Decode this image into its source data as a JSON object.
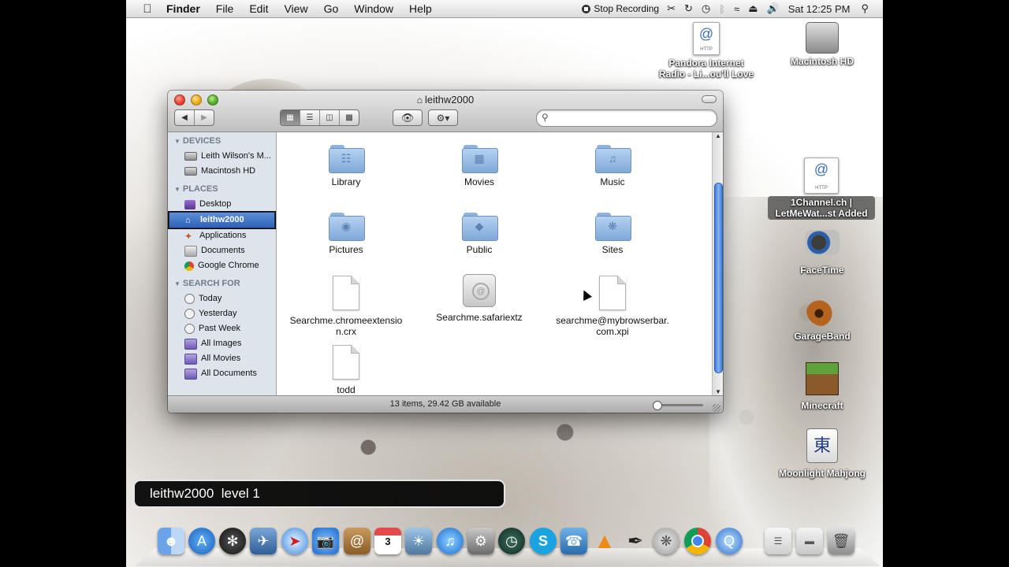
{
  "menubar": {
    "app_name": "Finder",
    "items": [
      "File",
      "Edit",
      "View",
      "Go",
      "Window",
      "Help"
    ],
    "recording_label": "Stop Recording",
    "clock": "Sat 12:25 PM"
  },
  "desktop": {
    "icons": [
      {
        "label": "Pandora Internet Radio - Li...ou'll Love"
      },
      {
        "label": "Macintosh HD"
      },
      {
        "label": "1Channel.ch | LetMeWat...st Added"
      },
      {
        "label": "FaceTime"
      },
      {
        "label": "GarageBand"
      },
      {
        "label": "Minecraft"
      },
      {
        "label": "Moonlight Mahjong"
      }
    ]
  },
  "finder": {
    "title": "leithw2000",
    "search_placeholder": "",
    "sidebar": {
      "devices_header": "DEVICES",
      "devices": [
        "Leith Wilson's M...",
        "Macintosh HD"
      ],
      "places_header": "PLACES",
      "places": [
        "Desktop",
        "leithw2000",
        "Applications",
        "Documents",
        "Google Chrome"
      ],
      "search_header": "SEARCH FOR",
      "search": [
        "Today",
        "Yesterday",
        "Past Week",
        "All Images",
        "All Movies",
        "All Documents"
      ]
    },
    "items": [
      {
        "name": "Library",
        "kind": "folder"
      },
      {
        "name": "Movies",
        "kind": "folder"
      },
      {
        "name": "Music",
        "kind": "folder"
      },
      {
        "name": "Pictures",
        "kind": "folder"
      },
      {
        "name": "Public",
        "kind": "folder"
      },
      {
        "name": "Sites",
        "kind": "folder"
      },
      {
        "name": "Searchme.chromeextension.crx",
        "line1": "Searchme.chromeextensio",
        "line2": "n.crx",
        "kind": "file"
      },
      {
        "name": "Searchme.safariextz",
        "kind": "extension"
      },
      {
        "name": "searchme@mybrowserbar.com.xpi",
        "line1": "searchme@mybrowserbar.",
        "line2": "com.xpi",
        "kind": "file"
      },
      {
        "name": "todd",
        "kind": "file"
      }
    ],
    "status": "13 items, 29.42 GB available"
  },
  "keystroke_hud": "leithw2000  level 1",
  "colors": {
    "selection": "#2c61b8",
    "sidebar_bg": "#dde4ec",
    "folder": "#9fc2e8"
  }
}
